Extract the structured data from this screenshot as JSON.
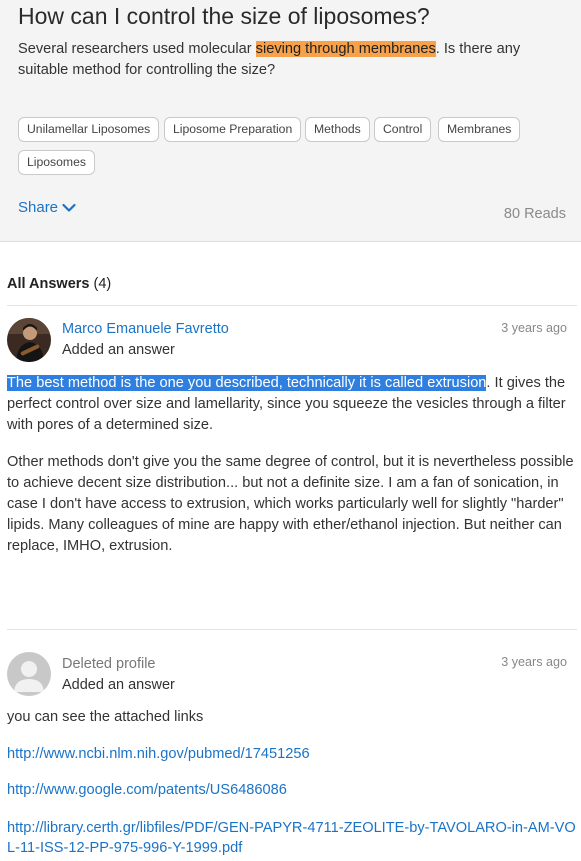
{
  "question": {
    "title": "How can I control the size of liposomes?",
    "body_before": "Several researchers used molecular ",
    "body_highlight": "sieving through membranes",
    "body_after": ". Is there any suitable method for controlling the size?",
    "tags": [
      "Unilamellar Liposomes",
      "Liposome Preparation",
      "Methods",
      "Control",
      "Membranes",
      "Liposomes"
    ],
    "share_label": "Share",
    "reads": "80 Reads"
  },
  "answers": {
    "heading_label": "All Answers",
    "count_label": "(4)",
    "items": [
      {
        "author": "Marco Emanuele Favretto",
        "action": "Added an answer",
        "time": "3 years ago",
        "p1_highlight": "The best method is the one you described, technically it is called extrusion",
        "p1_rest": ". It gives the perfect control over size and lamellarity, since you squeeze the vesicles through a filter with pores of a determined size.",
        "p2": "Other methods don't give you the same degree of control, but it is nevertheless possible to achieve decent size distribution... but not a definite size. I am a fan of sonication, in case I don't have access to extrusion, which works particularly well for slightly \"harder\" lipids. Many colleagues of mine are happy with ether/ethanol injection. But neither can replace, IMHO, extrusion."
      },
      {
        "author": "Deleted profile",
        "action": "Added an answer",
        "time": "3 years ago",
        "text": "you can see the attached links",
        "links": [
          "http://www.ncbi.nlm.nih.gov/pubmed/17451256",
          "http://www.google.com/patents/US6486086",
          "http://library.certh.gr/libfiles/PDF/GEN-PAPYR-4711-ZEOLITE-by-TAVOLARO-in-AM-VOL-11-ISS-12-PP-975-996-Y-1999.pdf"
        ]
      }
    ]
  },
  "colors": {
    "link": "#1b73c7",
    "question_highlight": "#f7a24a",
    "selection_highlight": "#2f7fe0"
  }
}
